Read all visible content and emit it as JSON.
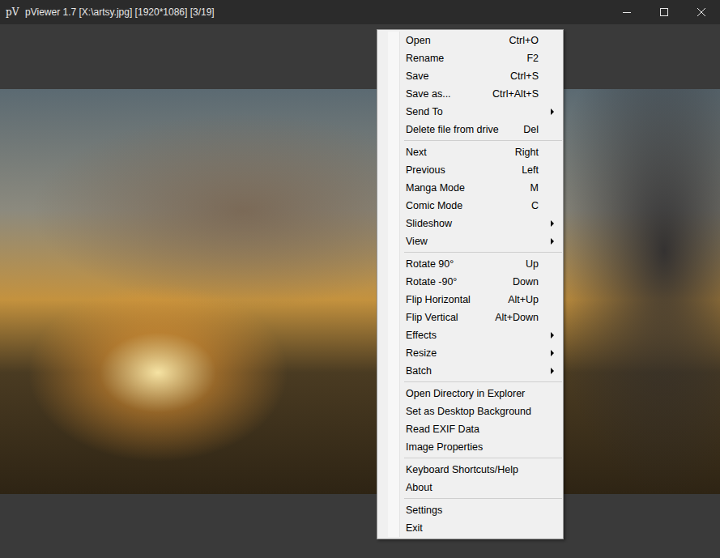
{
  "window": {
    "logo": "pV",
    "title": "pViewer 1.7 [X:\\artsy.jpg] [1920*1086] [3/19]"
  },
  "menu": {
    "groups": [
      [
        {
          "label": "Open",
          "shortcut": "Ctrl+O",
          "submenu": false
        },
        {
          "label": "Rename",
          "shortcut": "F2",
          "submenu": false
        },
        {
          "label": "Save",
          "shortcut": "Ctrl+S",
          "submenu": false
        },
        {
          "label": "Save as...",
          "shortcut": "Ctrl+Alt+S",
          "submenu": false
        },
        {
          "label": "Send To",
          "shortcut": "",
          "submenu": true
        },
        {
          "label": "Delete file from drive",
          "shortcut": "Del",
          "submenu": false
        }
      ],
      [
        {
          "label": "Next",
          "shortcut": "Right",
          "submenu": false
        },
        {
          "label": "Previous",
          "shortcut": "Left",
          "submenu": false
        },
        {
          "label": "Manga Mode",
          "shortcut": "M",
          "submenu": false
        },
        {
          "label": "Comic Mode",
          "shortcut": "C",
          "submenu": false
        },
        {
          "label": "Slideshow",
          "shortcut": "",
          "submenu": true
        },
        {
          "label": "View",
          "shortcut": "",
          "submenu": true
        }
      ],
      [
        {
          "label": "Rotate 90°",
          "shortcut": "Up",
          "submenu": false
        },
        {
          "label": "Rotate -90°",
          "shortcut": "Down",
          "submenu": false
        },
        {
          "label": "Flip Horizontal",
          "shortcut": "Alt+Up",
          "submenu": false
        },
        {
          "label": "Flip Vertical",
          "shortcut": "Alt+Down",
          "submenu": false
        },
        {
          "label": "Effects",
          "shortcut": "",
          "submenu": true
        },
        {
          "label": "Resize",
          "shortcut": "",
          "submenu": true
        },
        {
          "label": "Batch",
          "shortcut": "",
          "submenu": true
        }
      ],
      [
        {
          "label": "Open Directory in Explorer",
          "shortcut": "",
          "submenu": false
        },
        {
          "label": "Set as Desktop Background",
          "shortcut": "",
          "submenu": false
        },
        {
          "label": "Read EXIF Data",
          "shortcut": "",
          "submenu": false
        },
        {
          "label": "Image Properties",
          "shortcut": "",
          "submenu": false
        }
      ],
      [
        {
          "label": "Keyboard Shortcuts/Help",
          "shortcut": "",
          "submenu": false
        },
        {
          "label": "About",
          "shortcut": "",
          "submenu": false
        }
      ],
      [
        {
          "label": "Settings",
          "shortcut": "",
          "submenu": false
        },
        {
          "label": "Exit",
          "shortcut": "",
          "submenu": false
        }
      ]
    ]
  }
}
